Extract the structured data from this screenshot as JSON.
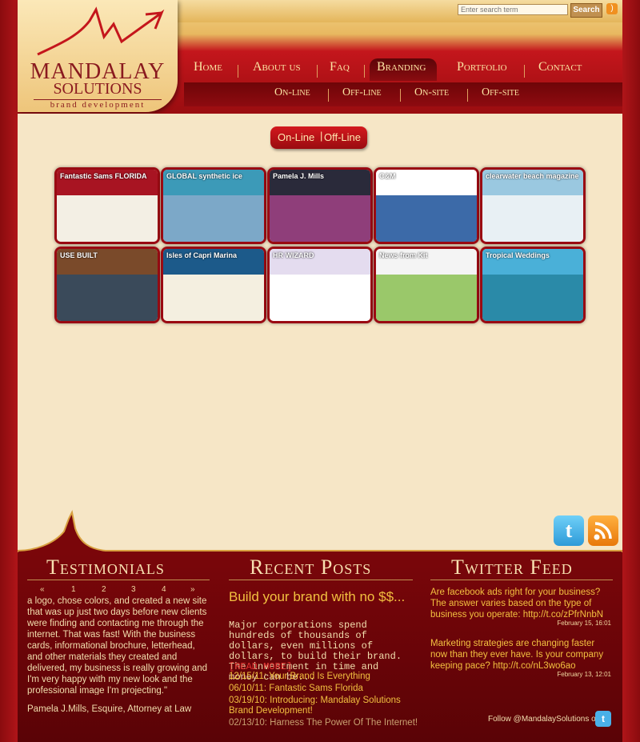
{
  "brand": {
    "name_line1": "MANDALAY",
    "name_line2": "SOLUTIONS",
    "tagline": "brand development"
  },
  "search": {
    "placeholder": "Enter search term",
    "button": "Search"
  },
  "nav": {
    "items": [
      "Home",
      "About us",
      "Faq",
      "Branding",
      "Portfolio",
      "Contact"
    ],
    "active": "Branding"
  },
  "subnav": {
    "items": [
      "On-line",
      "Off-line",
      "On-site",
      "Off-site"
    ]
  },
  "filter": {
    "online": "On-Line",
    "offline": "Off-Line"
  },
  "thumbnails": [
    {
      "label": "Fantastic Sams FLORIDA",
      "color1": "#a81422",
      "color2": "#f3efe4"
    },
    {
      "label": "GLOBAL synthetic ice",
      "color1": "#3c9ab8",
      "color2": "#7ca8c8"
    },
    {
      "label": "Pamela J. Mills",
      "color1": "#2a2a3a",
      "color2": "#8f3e7a"
    },
    {
      "label": "C&M",
      "color1": "#ffffff",
      "color2": "#3c6aa8"
    },
    {
      "label": "clearwater beach magazine",
      "color1": "#9ac8e0",
      "color2": "#e8f0f4"
    },
    {
      "label": "USE BUILT",
      "color1": "#7a4a2a",
      "color2": "#3a4a5a"
    },
    {
      "label": "Isles of Capri Marina",
      "color1": "#1c5a8a",
      "color2": "#f4efe0"
    },
    {
      "label": "HR WIZARD",
      "color1": "#e4dcef",
      "color2": "#ffffff"
    },
    {
      "label": "News from Kit",
      "color1": "#f4f4f4",
      "color2": "#9ac86a"
    },
    {
      "label": "Tropical Weddings",
      "color1": "#4ab0d8",
      "color2": "#2a8aa8"
    }
  ],
  "testimonials": {
    "title": "Testimonials",
    "pager": [
      "«",
      "1",
      "2",
      "3",
      "4",
      "»"
    ],
    "text": "a logo, chose colors, and created a new site that was up just two days before new clients were finding and contacting me through the internet. That was fast! With the business cards, informational brochure, letterhead, and other materials they created and delivered, my business is really growing and I'm very happy with my new look and the professional image I'm projecting.\"",
    "author": "Pamela J.Mills, Esquire, Attorney at Law"
  },
  "recent_posts": {
    "title": "Recent Posts",
    "headline": "Build your brand with no $$...",
    "excerpt": "Major corporations spend hundreds of thousands of dollars, even millions of dollars, to build their brand. The investment in time and money can be...",
    "read_more": "[READ MORE]",
    "links": [
      "12/15/11: Your Brand Is Everything",
      "06/10/11: Fantastic Sams Florida",
      "03/19/10: Introducing: Mandalay Solutions Brand Development!",
      "02/13/10: Harness The Power Of The Internet!"
    ]
  },
  "twitter": {
    "title": "Twitter Feed",
    "tweets": [
      {
        "text": "Are facebook ads right for your business? The answer varies based on the type of business you operate: http://t.co/zPfrNnbN",
        "date": "February 15, 16:01"
      },
      {
        "text": "Marketing strategies are changing faster now than they ever have. Is your company keeping pace? http://t.co/nL3wo6ao",
        "date": "February 13, 12:01"
      }
    ],
    "follow": "Follow @MandalaySolutions on"
  }
}
